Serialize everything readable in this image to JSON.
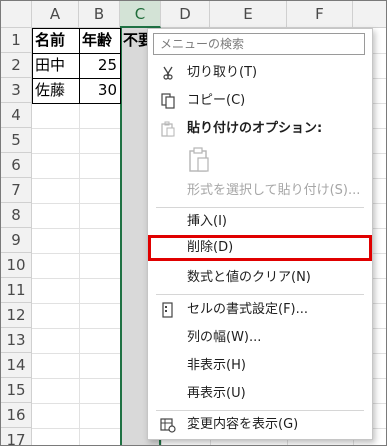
{
  "spreadsheet": {
    "columns": [
      "A",
      "B",
      "C",
      "D",
      "E",
      "F"
    ],
    "rows": [
      "1",
      "2",
      "3",
      "4",
      "5",
      "6",
      "7",
      "8",
      "9",
      "10",
      "11",
      "12",
      "13",
      "14",
      "15",
      "16",
      "17"
    ],
    "cells": {
      "A1": "名前",
      "B1": "年齢",
      "C1": "不要",
      "A2": "田中",
      "B2": "25",
      "A3": "佐藤",
      "B3": "30"
    },
    "selected_column": "C"
  },
  "context_menu": {
    "search_placeholder": "メニューの検索",
    "items": {
      "cut": "切り取り(T)",
      "copy": "コピー(C)",
      "paste_options": "貼り付けのオプション:",
      "paste_special": "形式を選択して貼り付け(S)...",
      "insert": "挿入(I)",
      "delete": "削除(D)",
      "clear": "数式と値のクリア(N)",
      "format_cells": "セルの書式設定(F)...",
      "column_width": "列の幅(W)...",
      "hide": "非表示(H)",
      "unhide": "再表示(U)",
      "show_changes": "変更内容を表示(G)"
    },
    "highlight_color": "#e00000"
  }
}
